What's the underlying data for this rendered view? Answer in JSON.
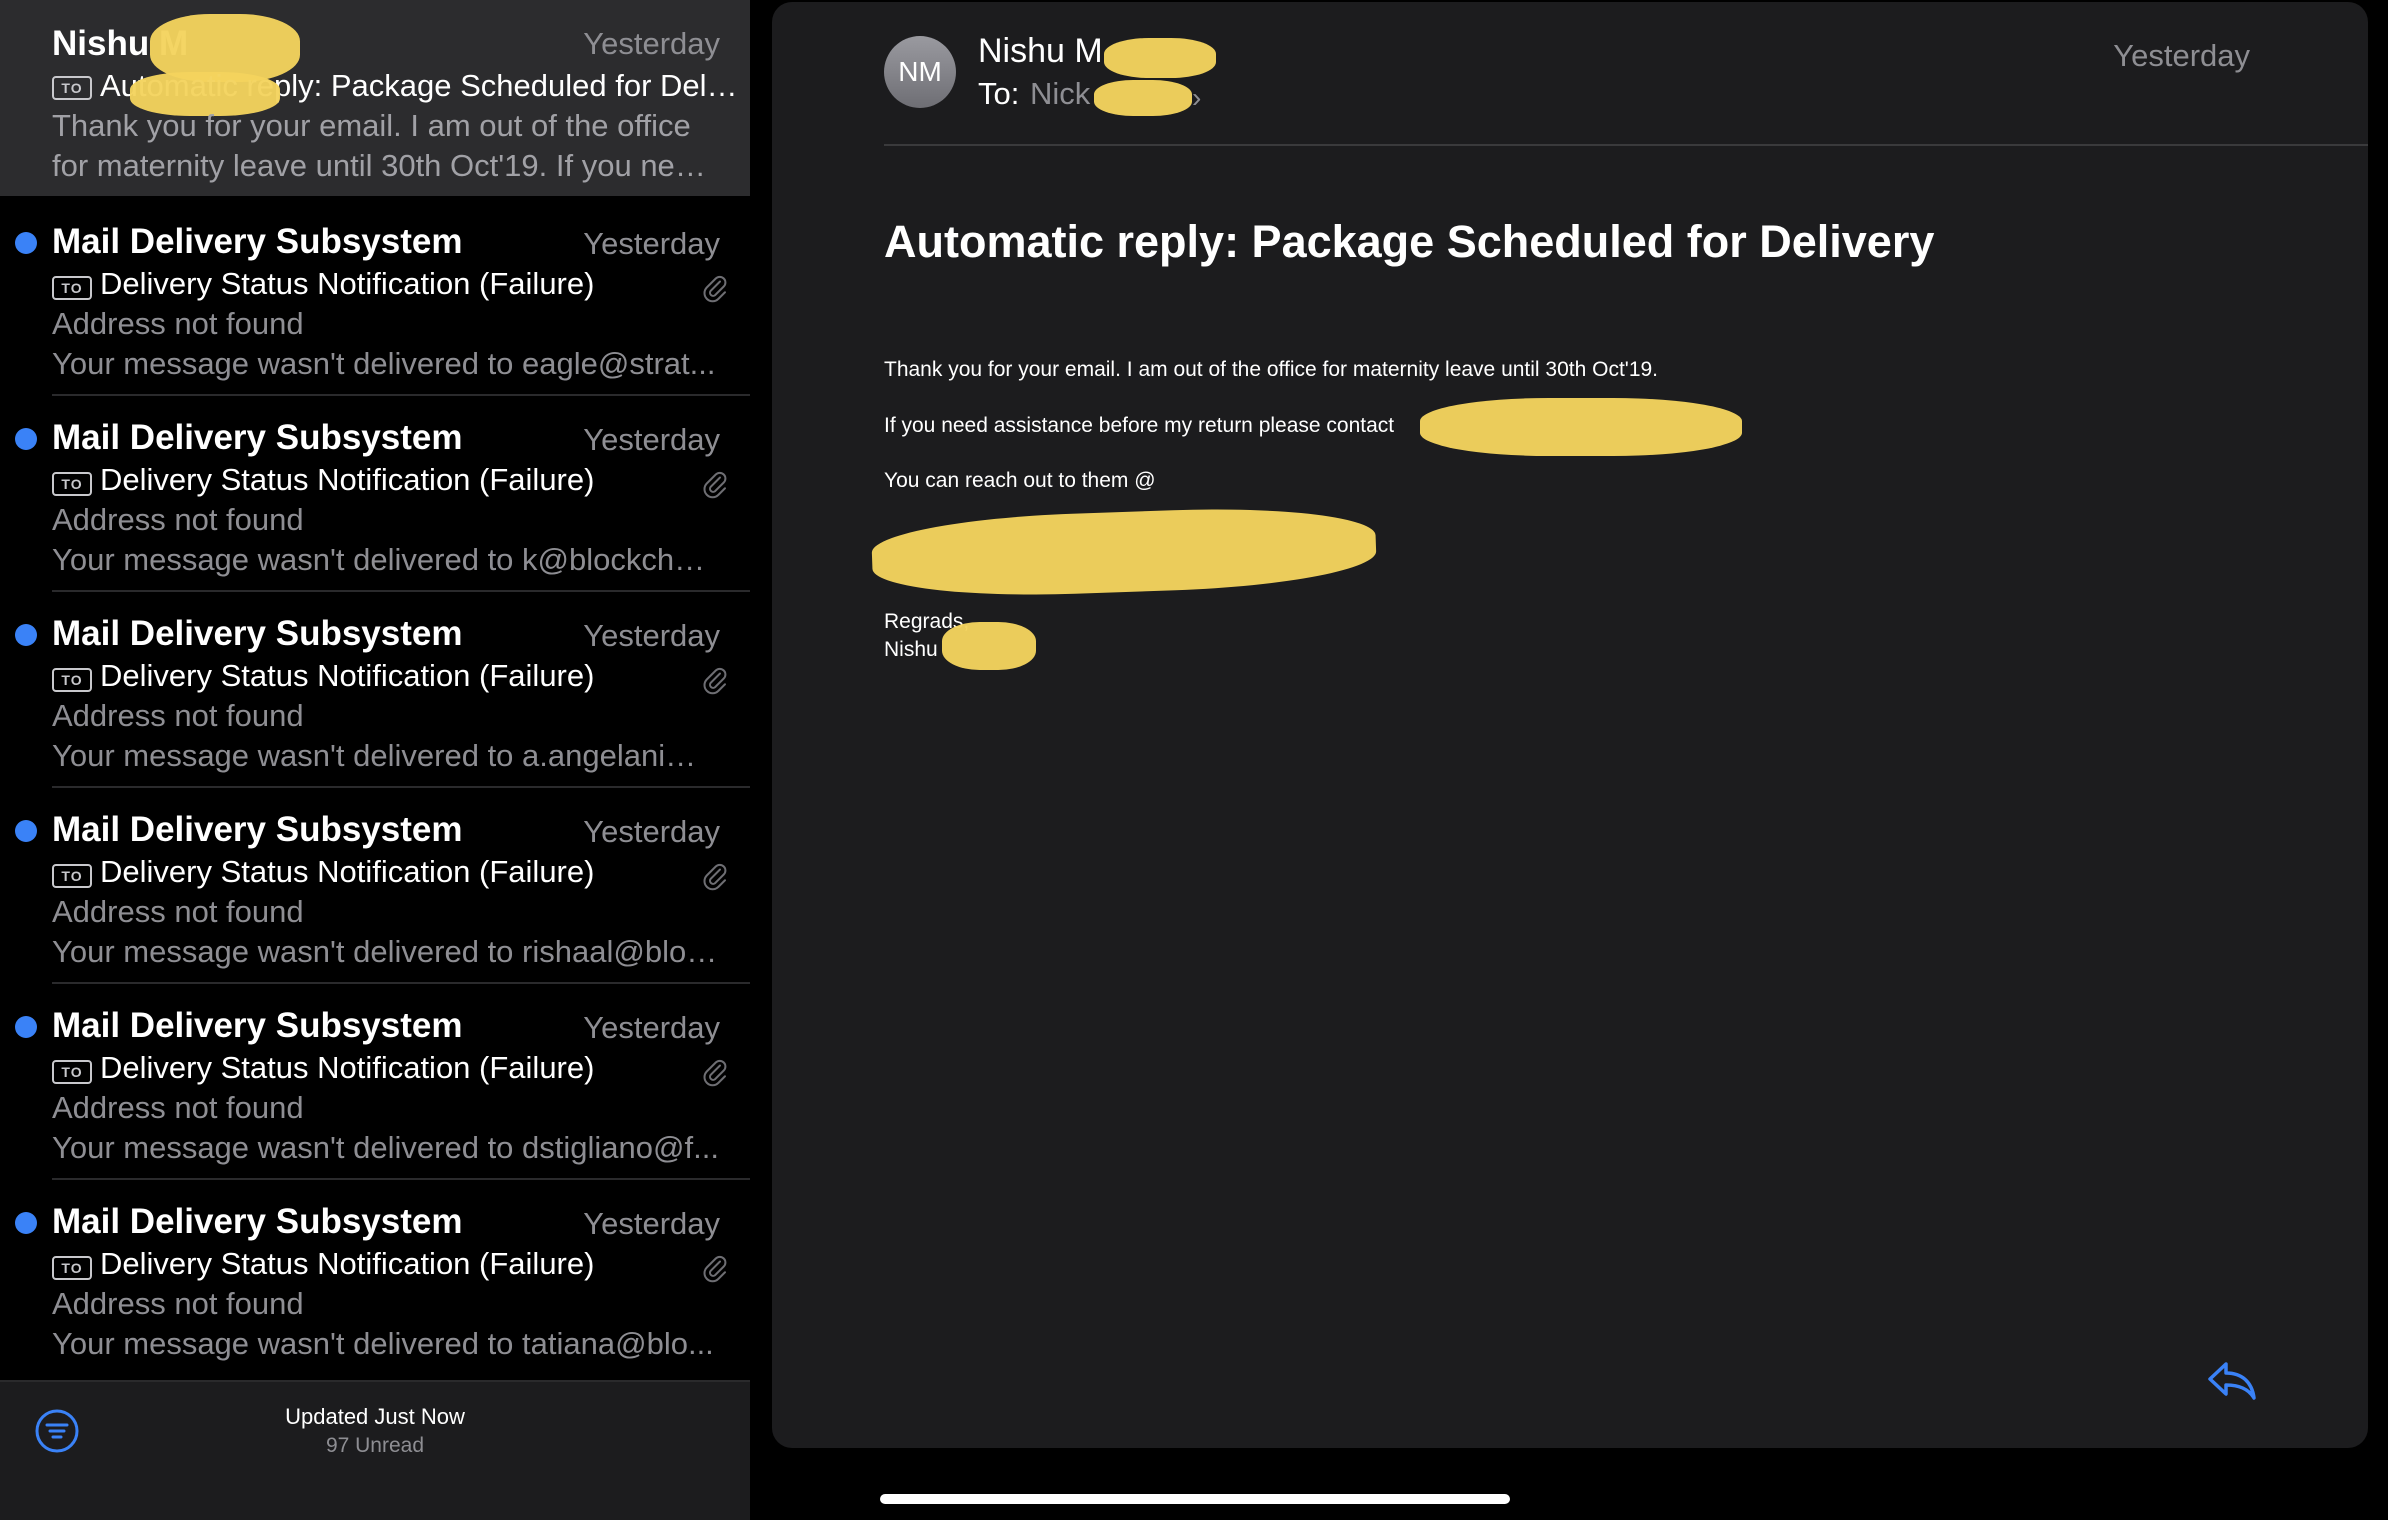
{
  "list": {
    "messages": [
      {
        "sender": "Nishu M",
        "date": "Yesterday",
        "subject": "Automatic reply: Package Scheduled for Delivery",
        "preview_line1": "Thank you for your email. I am out of the office",
        "preview_line2": "for maternity leave until 30th Oct'19. If you need assistance before my return please contact",
        "tag": "TO",
        "unread": false,
        "attachment": false,
        "selected": true
      },
      {
        "sender": "Mail Delivery Subsystem",
        "date": "Yesterday",
        "subject": "Delivery Status Notification (Failure)",
        "preview_line1": "Address not found",
        "preview_line2": "Your message wasn't delivered to eagle@strat...",
        "tag": "TO",
        "unread": true,
        "attachment": true
      },
      {
        "sender": "Mail Delivery Subsystem",
        "date": "Yesterday",
        "subject": "Delivery Status Notification (Failure)",
        "preview_line1": "Address not found",
        "preview_line2": "Your message wasn't delivered to k@blockchai...",
        "tag": "TO",
        "unread": true,
        "attachment": true
      },
      {
        "sender": "Mail Delivery Subsystem",
        "date": "Yesterday",
        "subject": "Delivery Status Notification (Failure)",
        "preview_line1": "Address not found",
        "preview_line2": "Your message wasn't delivered to a.angelani@f...",
        "tag": "TO",
        "unread": true,
        "attachment": true
      },
      {
        "sender": "Mail Delivery Subsystem",
        "date": "Yesterday",
        "subject": "Delivery Status Notification (Failure)",
        "preview_line1": "Address not found",
        "preview_line2": "Your message wasn't delivered to rishaal@bloc...",
        "tag": "TO",
        "unread": true,
        "attachment": true
      },
      {
        "sender": "Mail Delivery Subsystem",
        "date": "Yesterday",
        "subject": "Delivery Status Notification (Failure)",
        "preview_line1": "Address not found",
        "preview_line2": "Your message wasn't delivered to dstigliano@f...",
        "tag": "TO",
        "unread": true,
        "attachment": true
      },
      {
        "sender": "Mail Delivery Subsystem",
        "date": "Yesterday",
        "subject": "Delivery Status Notification (Failure)",
        "preview_line1": "Address not found",
        "preview_line2": "Your message wasn't delivered to tatiana@blo...",
        "tag": "TO",
        "unread": true,
        "attachment": true
      }
    ],
    "toolbar": {
      "status": "Updated Just Now",
      "unread_count": "97 Unread",
      "filter_icon": "filter-icon"
    }
  },
  "reader": {
    "avatar_initials": "NM",
    "from": "Nishu M",
    "to_label": "To:",
    "to_name": "Nick",
    "date": "Yesterday",
    "subject": "Automatic reply: Package Scheduled for Delivery",
    "body": {
      "line1": "Thank you for your email. I am out of the office for maternity leave until 30th Oct'19.",
      "line2": "If you need assistance before my return please contact",
      "line3": "You can reach out to them @",
      "line4": "",
      "line5": "",
      "line6": "Regrads,",
      "line7": "Nishu"
    },
    "reply_icon": "reply-icon"
  },
  "colors": {
    "unread_dot": "#3a82f7",
    "accent": "#3a82f7",
    "redaction": "#f4d35e",
    "reader_bg": "#1c1c1e",
    "selected_row_bg": "#2c2c2e"
  }
}
